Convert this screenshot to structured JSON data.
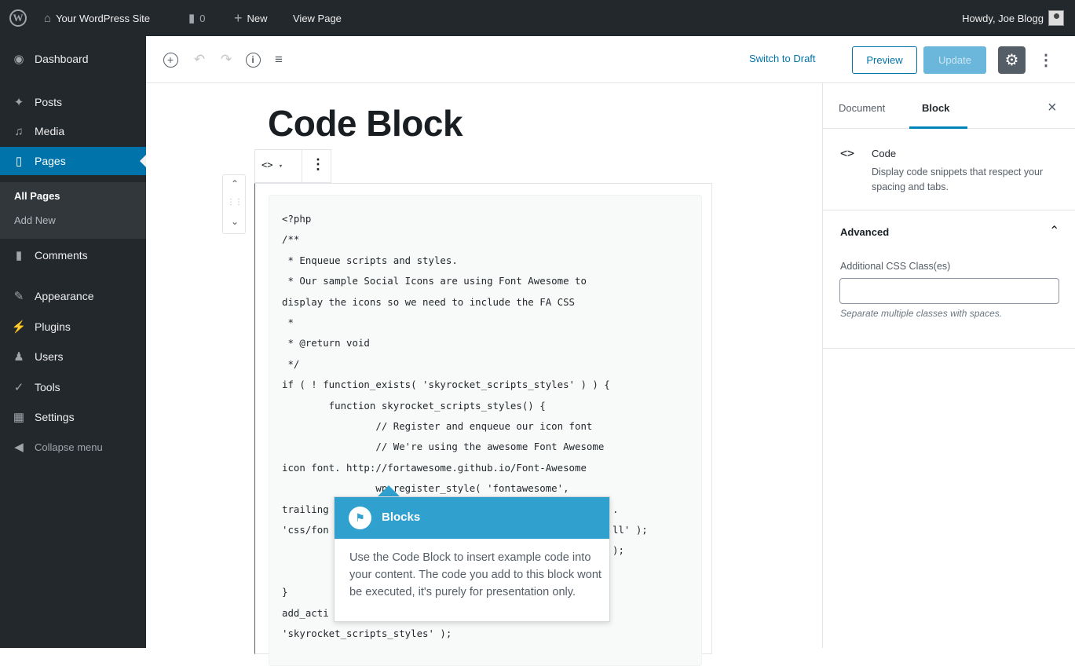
{
  "admin_bar": {
    "site_name": "Your WordPress Site",
    "comments_count": "0",
    "new_label": "New",
    "view_page_label": "View Page",
    "howdy": "Howdy, Joe Blogg"
  },
  "sidebar": {
    "items": [
      {
        "label": "Dashboard",
        "icon": "dashboard-icon"
      },
      {
        "label": "Posts",
        "icon": "pin-icon"
      },
      {
        "label": "Media",
        "icon": "media-icon"
      },
      {
        "label": "Pages",
        "icon": "pages-icon"
      },
      {
        "label": "Comments",
        "icon": "comment-icon"
      },
      {
        "label": "Appearance",
        "icon": "brush-icon"
      },
      {
        "label": "Plugins",
        "icon": "plug-icon"
      },
      {
        "label": "Users",
        "icon": "users-icon"
      },
      {
        "label": "Tools",
        "icon": "wrench-icon"
      },
      {
        "label": "Settings",
        "icon": "settings-icon"
      },
      {
        "label": "Collapse menu",
        "icon": "collapse-icon"
      }
    ],
    "submenu": [
      "All Pages",
      "Add New"
    ]
  },
  "header": {
    "switch_to_draft": "Switch to Draft",
    "preview": "Preview",
    "update": "Update"
  },
  "panel": {
    "tab_document": "Document",
    "tab_block": "Block",
    "block_icon": "<>",
    "block_name": "Code",
    "block_description": "Display code snippets that respect your spacing and tabs.",
    "advanced_title": "Advanced",
    "css_label": "Additional CSS Class(es)",
    "css_value": "",
    "css_help": "Separate multiple classes with spaces."
  },
  "content": {
    "title": "Code Block",
    "block_type_icon": "<>",
    "code_lines": [
      "<?php",
      "/**",
      " * Enqueue scripts and styles.",
      " * Our sample Social Icons are using Font Awesome to",
      "display the icons so we need to include the FA CSS",
      " *",
      " * @return void",
      " */",
      "if ( ! function_exists( 'skyrocket_scripts_styles' ) ) {",
      "        function skyrocket_scripts_styles() {",
      "                // Register and enqueue our icon font",
      "                // We're using the awesome Font Awesome",
      "icon font. http://fortawesome.github.io/Font-Awesome",
      "                wp_register_style( 'fontawesome',",
      "trailing",
      "'css/fon",
      "",
      "",
      "}",
      "add_acti",
      "'skyrocket_scripts_styles' );"
    ],
    "code_tails": [
      "",
      "",
      "",
      "",
      "",
      "",
      "",
      "",
      "",
      "",
      "",
      "",
      "",
      "",
      ".",
      "ll' );",
      ");",
      "",
      "",
      "",
      ""
    ]
  },
  "tooltip": {
    "title": "Blocks",
    "body": "Use the Code Block to insert example code into your content. The code you add to this block wont be executed, it's purely for presentation only."
  },
  "colors": {
    "admin_bar": "#23282d",
    "accent": "#0073aa",
    "tooltip": "#30a0ce"
  }
}
